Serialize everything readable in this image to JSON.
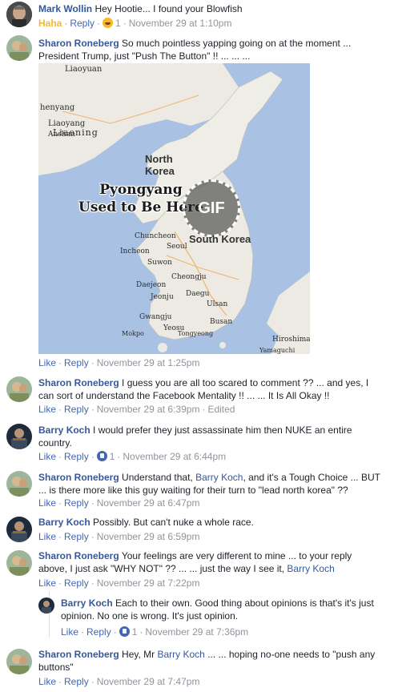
{
  "comments": [
    {
      "author": "Mark Wollin",
      "text": "Hey Hootie... I found your Blowfish",
      "reaction_label": "Haha",
      "reply": "Reply",
      "reaction_count": "1",
      "time": "November 29 at 1:10pm"
    },
    {
      "author": "Sharon Roneberg",
      "text": "So much pointless yapping going on at the moment ... President Trump, just \"Push The Button\" !! ... ... ...",
      "like": "Like",
      "reply": "Reply",
      "time": "November 29 at 1:25pm"
    },
    {
      "author": "Sharon Roneberg",
      "text": "I guess you are all too scared to comment ?? ... and yes, I can sort of understand the Facebook Mentality !! ... ... It Is All Okay !!",
      "like": "Like",
      "reply": "Reply",
      "time": "November 29 at 6:39pm",
      "edited": "Edited"
    },
    {
      "author": "Barry Koch",
      "text": "I would prefer they just assassinate him then NUKE an entire country.",
      "like": "Like",
      "reply": "Reply",
      "reaction_count": "1",
      "time": "November 29 at 6:44pm"
    },
    {
      "author": "Sharon Roneberg",
      "text_a": "Understand that,",
      "mention": "Barry Koch",
      "text_b": ", and it's a Tough Choice ... BUT ... is there more like this guy waiting for their turn to \"lead north korea\" ??",
      "like": "Like",
      "reply": "Reply",
      "time": "November 29 at 6:47pm"
    },
    {
      "author": "Barry Koch",
      "text": "Possibly. But can't nuke a whole race.",
      "like": "Like",
      "reply": "Reply",
      "time": "November 29 at 6:59pm"
    },
    {
      "author": "Sharon Roneberg",
      "text_a": "Your feelings are very different to mine ... to your reply above, I just ask \"WHY NOT\" ?? ... ... just the way I see it,",
      "mention": "Barry Koch",
      "like": "Like",
      "reply": "Reply",
      "time": "November 29 at 7:22pm"
    },
    {
      "author": "Barry Koch",
      "text": "Each to their own. Good thing about opinions is that's it's just opinion. No one is wrong. It's just opinion.",
      "like": "Like",
      "reply": "Reply",
      "reaction_count": "1",
      "time": "November 29 at 7:36pm"
    },
    {
      "author": "Sharon Roneberg",
      "text_a": "Hey, Mr",
      "mention": "Barry Koch",
      "text_b": "... ... hoping no-one needs to \"push any buttons\"",
      "like": "Like",
      "reply": "Reply",
      "time": "November 29 at 7:47pm"
    }
  ],
  "gif": {
    "overlay_line1": "Pyongyang",
    "overlay_line2": "Used to Be Here",
    "badge": "GIF",
    "labels": {
      "north_korea_1": "North",
      "north_korea_2": "Korea",
      "south_korea": "South Korea",
      "liaoning": "Liaoning",
      "shenyang": "henyang",
      "liaoyang": "Liaoyang",
      "anshan": "Anshan",
      "chuncheon": "Chuncheon",
      "seoul": "Seoul",
      "incheon": "Incheon",
      "suwon": "Suwon",
      "cheongju": "Cheongju",
      "daejeon": "Daejeon",
      "daegu": "Daegu",
      "jeonju": "Jeonju",
      "ulsan": "Ulsan",
      "gwangju": "Gwangju",
      "busan": "Busan",
      "yeosu": "Yeosu",
      "mokpo": "Mokpo",
      "tongyeong": "Tongyeong",
      "hiroshima": "Hiroshima",
      "yamaguchi": "Yamaguchi",
      "liaoyuan": "Liaoyuan"
    }
  },
  "colors": {
    "link": "#4267b2",
    "author": "#365899",
    "meta": "#90949c",
    "haha": "#f7b928",
    "sea": "#a9c2e4",
    "land": "#eceae2"
  }
}
